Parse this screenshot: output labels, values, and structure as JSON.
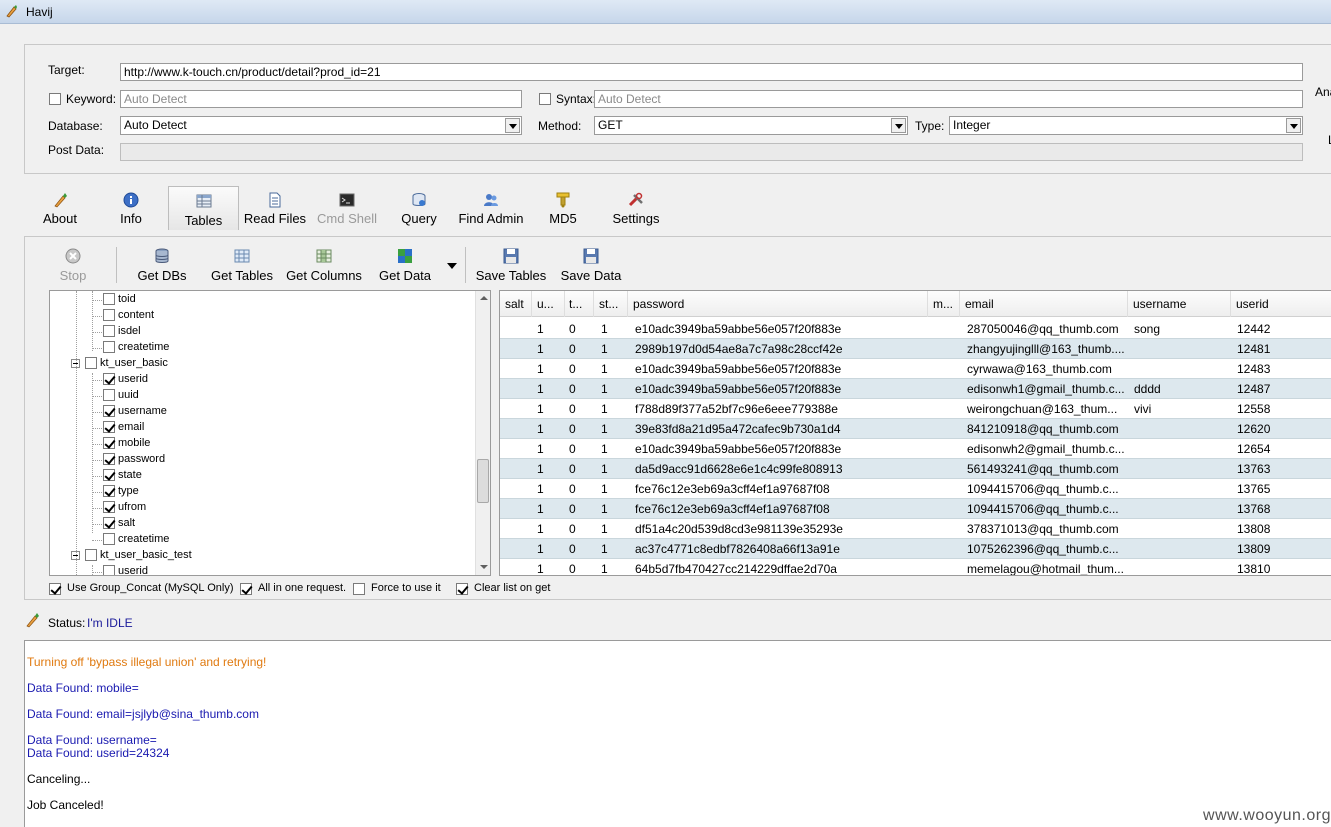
{
  "window": {
    "title": "Havij"
  },
  "form": {
    "target_label": "Target:",
    "target_value": "http://www.k-touch.cn/product/detail?prod_id=21",
    "keyword_label": "Keyword:",
    "keyword_placeholder": "Auto Detect",
    "syntax_label": "Syntax:",
    "syntax_placeholder": "Auto Detect",
    "database_label": "Database:",
    "database_value": "Auto Detect",
    "method_label": "Method:",
    "method_value": "GET",
    "type_label": "Type:",
    "type_value": "Integer",
    "postdata_label": "Post Data:",
    "right_clip_1": "Ana",
    "right_clip_2": "L"
  },
  "tabs": [
    {
      "label": "About",
      "icon": "about-icon"
    },
    {
      "label": "Info",
      "icon": "info-icon"
    },
    {
      "label": "Tables",
      "icon": "tables-icon",
      "active": true
    },
    {
      "label": "Read Files",
      "icon": "file-icon"
    },
    {
      "label": "Cmd Shell",
      "icon": "terminal-icon",
      "disabled": true
    },
    {
      "label": "Query",
      "icon": "query-icon"
    },
    {
      "label": "Find Admin",
      "icon": "admin-icon"
    },
    {
      "label": "MD5",
      "icon": "md5-icon"
    },
    {
      "label": "Settings",
      "icon": "settings-icon"
    }
  ],
  "toolbar": {
    "stop": "Stop",
    "get_dbs": "Get DBs",
    "get_tables": "Get Tables",
    "get_columns": "Get Columns",
    "get_data": "Get Data",
    "save_tables": "Save Tables",
    "save_data": "Save Data"
  },
  "tree": {
    "items": [
      {
        "label": "toid",
        "level": 2,
        "checked": false
      },
      {
        "label": "content",
        "level": 2,
        "checked": false
      },
      {
        "label": "isdel",
        "level": 2,
        "checked": false
      },
      {
        "label": "createtime",
        "level": 2,
        "checked": false
      },
      {
        "label": "kt_user_basic",
        "level": 1,
        "checked": false,
        "expander": true
      },
      {
        "label": "userid",
        "level": 2,
        "checked": true
      },
      {
        "label": "uuid",
        "level": 2,
        "checked": false
      },
      {
        "label": "username",
        "level": 2,
        "checked": true
      },
      {
        "label": "email",
        "level": 2,
        "checked": true
      },
      {
        "label": "mobile",
        "level": 2,
        "checked": true
      },
      {
        "label": "password",
        "level": 2,
        "checked": true
      },
      {
        "label": "state",
        "level": 2,
        "checked": true
      },
      {
        "label": "type",
        "level": 2,
        "checked": true
      },
      {
        "label": "ufrom",
        "level": 2,
        "checked": true
      },
      {
        "label": "salt",
        "level": 2,
        "checked": true
      },
      {
        "label": "createtime",
        "level": 2,
        "checked": false
      },
      {
        "label": "kt_user_basic_test",
        "level": 1,
        "checked": false,
        "expander": true
      },
      {
        "label": "userid",
        "level": 2,
        "checked": false
      }
    ]
  },
  "grid": {
    "columns": [
      "salt",
      "u...",
      "t...",
      "st...",
      "password",
      "m...",
      "email",
      "username",
      "userid"
    ],
    "rows": [
      [
        "",
        "1",
        "0",
        "1",
        "e10adc3949ba59abbe56e057f20f883e",
        "",
        "287050046@qq_thumb.com",
        "song",
        "12442"
      ],
      [
        "",
        "1",
        "0",
        "1",
        "2989b197d0d54ae8a7c7a98c28ccf42e",
        "",
        "zhangyujinglll@163_thumb....",
        "",
        "12481"
      ],
      [
        "",
        "1",
        "0",
        "1",
        "e10adc3949ba59abbe56e057f20f883e",
        "",
        "cyrwawa@163_thumb.com",
        "",
        "12483"
      ],
      [
        "",
        "1",
        "0",
        "1",
        "e10adc3949ba59abbe56e057f20f883e",
        "",
        "edisonwh1@gmail_thumb.c...",
        "dddd",
        "12487"
      ],
      [
        "",
        "1",
        "0",
        "1",
        "f788d89f377a52bf7c96e6eee779388e",
        "",
        "weirongchuan@163_thum...",
        "vivi",
        "12558"
      ],
      [
        "",
        "1",
        "0",
        "1",
        "39e83fd8a21d95a472cafec9b730a1d4",
        "",
        "841210918@qq_thumb.com",
        "",
        "12620"
      ],
      [
        "",
        "1",
        "0",
        "1",
        "e10adc3949ba59abbe56e057f20f883e",
        "",
        "edisonwh2@gmail_thumb.c...",
        "",
        "12654"
      ],
      [
        "",
        "1",
        "0",
        "1",
        "da5d9acc91d6628e6e1c4c99fe808913",
        "",
        "561493241@qq_thumb.com",
        "",
        "13763"
      ],
      [
        "",
        "1",
        "0",
        "1",
        "fce76c12e3eb69a3cff4ef1a97687f08",
        "",
        "1094415706@qq_thumb.c...",
        "",
        "13765"
      ],
      [
        "",
        "1",
        "0",
        "1",
        "fce76c12e3eb69a3cff4ef1a97687f08",
        "",
        "1094415706@qq_thumb.c...",
        "",
        "13768"
      ],
      [
        "",
        "1",
        "0",
        "1",
        "df51a4c20d539d8cd3e981139e35293e",
        "",
        "378371013@qq_thumb.com",
        "",
        "13808"
      ],
      [
        "",
        "1",
        "0",
        "1",
        "ac37c4771c8edbf7826408a66f13a91e",
        "",
        "1075262396@qq_thumb.c...",
        "",
        "13809"
      ],
      [
        "",
        "1",
        "0",
        "1",
        "64b5d7fb470427cc214229dffae2d70a",
        "",
        "memelagou@hotmail_thum...",
        "",
        "13810"
      ]
    ]
  },
  "options": [
    {
      "label": "Use Group_Concat (MySQL Only)",
      "checked": true
    },
    {
      "label": "All in one request.",
      "checked": true
    },
    {
      "label": "Force to use it",
      "checked": false
    },
    {
      "label": "Clear list on get",
      "checked": true
    }
  ],
  "status": {
    "label": "Status:",
    "value": "I'm IDLE"
  },
  "log": [
    {
      "text": "Turning off 'bypass illegal union' and retrying!",
      "color": "#e07a10"
    },
    {
      "text": "Data Found: mobile=",
      "color": "#1a1ab0"
    },
    {
      "text": "Data Found: email=jsjlyb@sina_thumb.com",
      "color": "#1a1ab0"
    },
    {
      "text": "Data Found: username=",
      "color": "#1a1ab0"
    },
    {
      "text": "Data Found: userid=24324",
      "color": "#1a1ab0"
    },
    {
      "text": "Canceling...",
      "color": "#000000"
    },
    {
      "text": "Job Canceled!",
      "color": "#000000"
    }
  ],
  "watermark": "www.wooyun.org"
}
